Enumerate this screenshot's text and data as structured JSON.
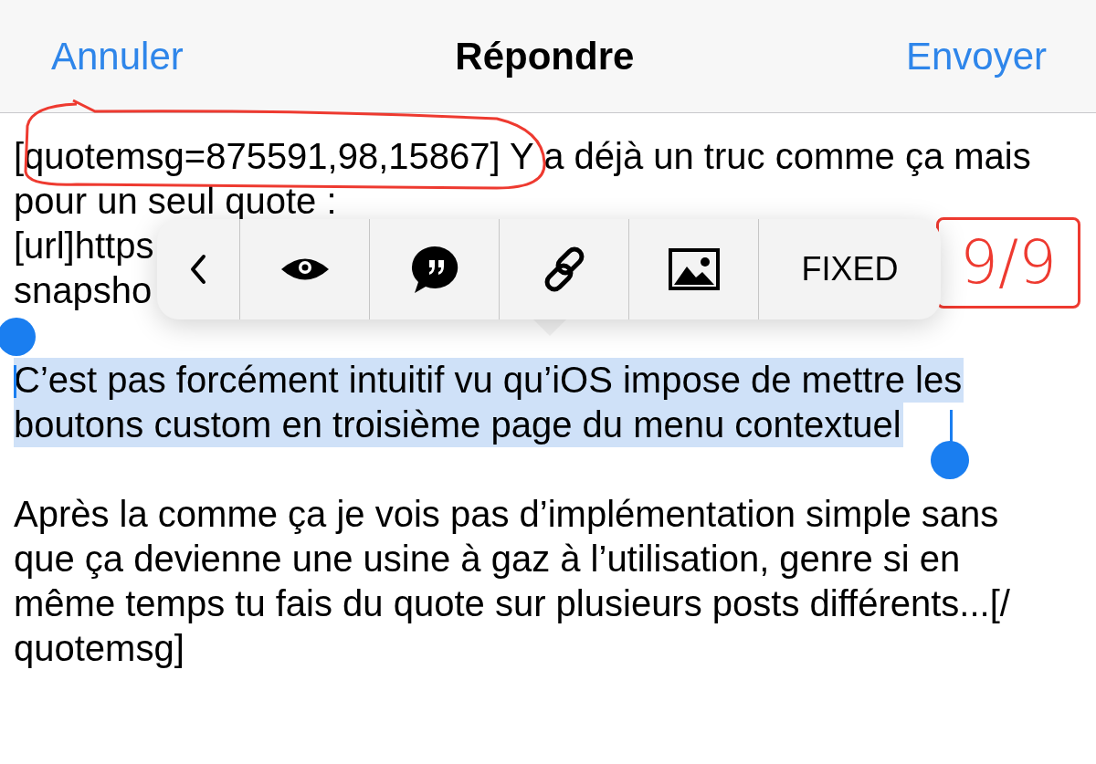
{
  "nav": {
    "cancel": "Annuler",
    "title": "Répondre",
    "send": "Envoyer"
  },
  "paragraphs": [
    {
      "selected": false,
      "lines": [
        "[quotemsg=875591,98,15867] Y a déjà un truc comme ça mais",
        "pour un seul quote :",
        "[url]https",
        "snapsho"
      ]
    },
    {
      "selected": true,
      "lines": [
        "C’est pas forcément intuitif vu qu’iOS impose de mettre les",
        "boutons custom en troisième page du menu contextuel"
      ]
    },
    {
      "selected": false,
      "lines": [
        "Après la comme ça je vois pas d’implémentation simple sans",
        "que ça devienne une usine à gaz à l’utilisation, genre si en",
        "même temps tu fais du quote sur plusieurs posts différents...[/",
        "quotemsg]"
      ]
    }
  ],
  "context_menu": {
    "items": [
      {
        "kind": "back"
      },
      {
        "kind": "eye"
      },
      {
        "kind": "quote"
      },
      {
        "kind": "link"
      },
      {
        "kind": "image"
      },
      {
        "kind": "text",
        "label": "FIXED"
      }
    ]
  },
  "annotations": [
    {
      "kind": "ellipse"
    },
    {
      "kind": "box",
      "text": "9/9"
    }
  ]
}
